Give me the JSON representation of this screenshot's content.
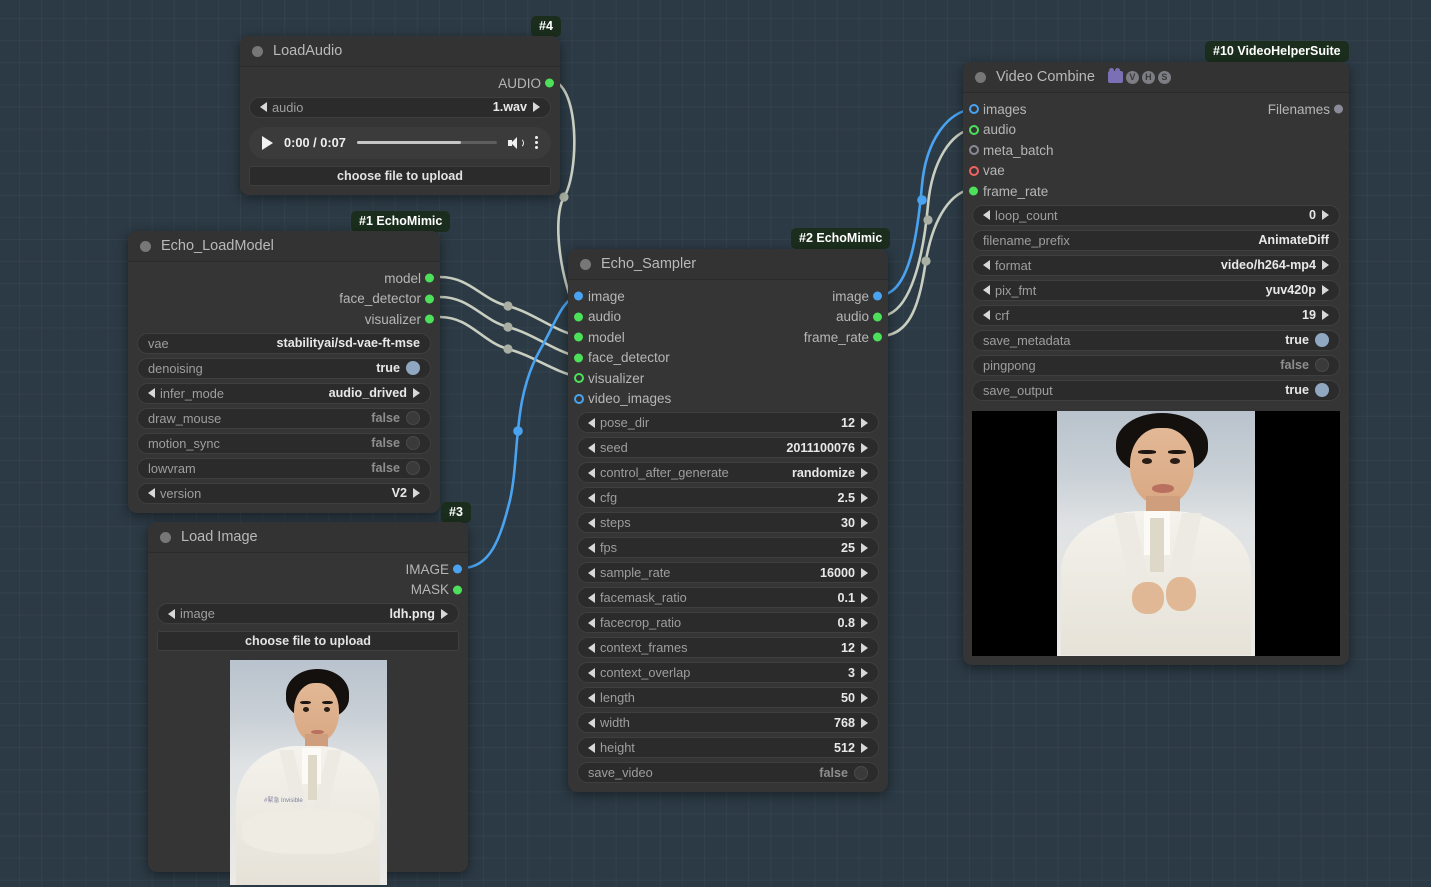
{
  "canvas": {
    "background_color": "#2c3a45",
    "grid": true
  },
  "link_colors": {
    "model": "#c8cec0",
    "audio": "#c8cec0",
    "image": "#4aa3f0"
  },
  "nodes": {
    "load_audio": {
      "badge": "#4",
      "title": "LoadAudio",
      "outputs": [
        {
          "label": "AUDIO",
          "dot": "green"
        }
      ],
      "widgets": [
        {
          "name": "audio",
          "value": "1.wav",
          "type": "combo"
        }
      ],
      "audio_player": {
        "time": "0:00 / 0:07",
        "progress_percent": 74
      },
      "upload_label": "choose file to upload"
    },
    "echo_loadmodel": {
      "badge": "#1 EchoMimic",
      "title": "Echo_LoadModel",
      "outputs": [
        {
          "label": "model",
          "dot": "green"
        },
        {
          "label": "face_detector",
          "dot": "green"
        },
        {
          "label": "visualizer",
          "dot": "green"
        }
      ],
      "widgets": [
        {
          "name": "vae",
          "value": "stabilityai/sd-vae-ft-mse",
          "type": "text"
        },
        {
          "name": "denoising",
          "value": "true",
          "type": "bool",
          "on": true
        },
        {
          "name": "infer_mode",
          "value": "audio_drived",
          "type": "combo"
        },
        {
          "name": "draw_mouse",
          "value": "false",
          "type": "bool",
          "on": false
        },
        {
          "name": "motion_sync",
          "value": "false",
          "type": "bool",
          "on": false
        },
        {
          "name": "lowvram",
          "value": "false",
          "type": "bool",
          "on": false
        },
        {
          "name": "version",
          "value": "V2",
          "type": "combo"
        }
      ]
    },
    "load_image": {
      "badge": "#3",
      "title": "Load Image",
      "outputs": [
        {
          "label": "IMAGE",
          "dot": "blue"
        },
        {
          "label": "MASK",
          "dot": "green"
        }
      ],
      "widgets": [
        {
          "name": "image",
          "value": "ldh.png",
          "type": "combo"
        }
      ],
      "upload_label": "choose file to upload",
      "preview_watermark": "#緊急 Invisible"
    },
    "echo_sampler": {
      "badge": "#2 EchoMimic",
      "title": "Echo_Sampler",
      "inputs": [
        {
          "label": "image",
          "dot": "blue"
        },
        {
          "label": "audio",
          "dot": "green"
        },
        {
          "label": "model",
          "dot": "green"
        },
        {
          "label": "face_detector",
          "dot": "green"
        },
        {
          "label": "visualizer",
          "dot": "ring-green"
        },
        {
          "label": "video_images",
          "dot": "ring-blue"
        }
      ],
      "outputs": [
        {
          "label": "image",
          "dot": "blue"
        },
        {
          "label": "audio",
          "dot": "green"
        },
        {
          "label": "frame_rate",
          "dot": "green"
        }
      ],
      "widgets": [
        {
          "name": "pose_dir",
          "value": "12",
          "type": "combo"
        },
        {
          "name": "seed",
          "value": "2011100076",
          "type": "combo"
        },
        {
          "name": "control_after_generate",
          "value": "randomize",
          "type": "combo"
        },
        {
          "name": "cfg",
          "value": "2.5",
          "type": "combo"
        },
        {
          "name": "steps",
          "value": "30",
          "type": "combo"
        },
        {
          "name": "fps",
          "value": "25",
          "type": "combo"
        },
        {
          "name": "sample_rate",
          "value": "16000",
          "type": "combo"
        },
        {
          "name": "facemask_ratio",
          "value": "0.1",
          "type": "combo"
        },
        {
          "name": "facecrop_ratio",
          "value": "0.8",
          "type": "combo"
        },
        {
          "name": "context_frames",
          "value": "12",
          "type": "combo"
        },
        {
          "name": "context_overlap",
          "value": "3",
          "type": "combo"
        },
        {
          "name": "length",
          "value": "50",
          "type": "combo"
        },
        {
          "name": "width",
          "value": "768",
          "type": "combo"
        },
        {
          "name": "height",
          "value": "512",
          "type": "combo"
        },
        {
          "name": "save_video",
          "value": "false",
          "type": "bool",
          "on": false
        }
      ]
    },
    "video_combine": {
      "badge": "#10 VideoHelperSuite",
      "title": "Video Combine",
      "title_badges": [
        "camera-icon",
        "V",
        "H",
        "S"
      ],
      "inputs": [
        {
          "label": "images",
          "dot": "ring-blue"
        },
        {
          "label": "audio",
          "dot": "ring-green"
        },
        {
          "label": "meta_batch",
          "dot": "ring-gray"
        },
        {
          "label": "vae",
          "dot": "ring-red"
        },
        {
          "label": "frame_rate",
          "dot": "green"
        }
      ],
      "outputs": [
        {
          "label": "Filenames",
          "dot": "gray"
        }
      ],
      "widgets": [
        {
          "name": "loop_count",
          "value": "0",
          "type": "combo"
        },
        {
          "name": "filename_prefix",
          "value": "AnimateDiff",
          "type": "text"
        },
        {
          "name": "format",
          "value": "video/h264-mp4",
          "type": "combo"
        },
        {
          "name": "pix_fmt",
          "value": "yuv420p",
          "type": "combo"
        },
        {
          "name": "crf",
          "value": "19",
          "type": "combo"
        },
        {
          "name": "save_metadata",
          "value": "true",
          "type": "bool",
          "on": true
        },
        {
          "name": "pingpong",
          "value": "false",
          "type": "bool",
          "on": false
        },
        {
          "name": "save_output",
          "value": "true",
          "type": "bool",
          "on": true
        }
      ]
    }
  }
}
